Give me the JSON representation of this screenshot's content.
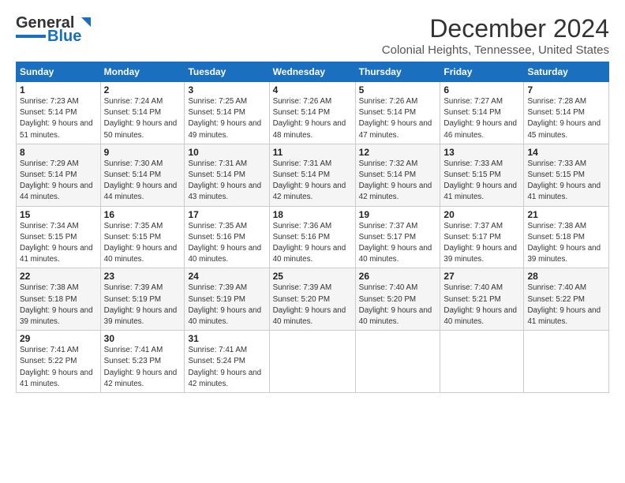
{
  "logo": {
    "part1": "General",
    "part2": "Blue"
  },
  "title": "December 2024",
  "location": "Colonial Heights, Tennessee, United States",
  "days_header": [
    "Sunday",
    "Monday",
    "Tuesday",
    "Wednesday",
    "Thursday",
    "Friday",
    "Saturday"
  ],
  "weeks": [
    [
      {
        "day": "1",
        "sunrise": "7:23 AM",
        "sunset": "5:14 PM",
        "daylight": "9 hours and 51 minutes."
      },
      {
        "day": "2",
        "sunrise": "7:24 AM",
        "sunset": "5:14 PM",
        "daylight": "9 hours and 50 minutes."
      },
      {
        "day": "3",
        "sunrise": "7:25 AM",
        "sunset": "5:14 PM",
        "daylight": "9 hours and 49 minutes."
      },
      {
        "day": "4",
        "sunrise": "7:26 AM",
        "sunset": "5:14 PM",
        "daylight": "9 hours and 48 minutes."
      },
      {
        "day": "5",
        "sunrise": "7:26 AM",
        "sunset": "5:14 PM",
        "daylight": "9 hours and 47 minutes."
      },
      {
        "day": "6",
        "sunrise": "7:27 AM",
        "sunset": "5:14 PM",
        "daylight": "9 hours and 46 minutes."
      },
      {
        "day": "7",
        "sunrise": "7:28 AM",
        "sunset": "5:14 PM",
        "daylight": "9 hours and 45 minutes."
      }
    ],
    [
      {
        "day": "8",
        "sunrise": "7:29 AM",
        "sunset": "5:14 PM",
        "daylight": "9 hours and 44 minutes."
      },
      {
        "day": "9",
        "sunrise": "7:30 AM",
        "sunset": "5:14 PM",
        "daylight": "9 hours and 44 minutes."
      },
      {
        "day": "10",
        "sunrise": "7:31 AM",
        "sunset": "5:14 PM",
        "daylight": "9 hours and 43 minutes."
      },
      {
        "day": "11",
        "sunrise": "7:31 AM",
        "sunset": "5:14 PM",
        "daylight": "9 hours and 42 minutes."
      },
      {
        "day": "12",
        "sunrise": "7:32 AM",
        "sunset": "5:14 PM",
        "daylight": "9 hours and 42 minutes."
      },
      {
        "day": "13",
        "sunrise": "7:33 AM",
        "sunset": "5:15 PM",
        "daylight": "9 hours and 41 minutes."
      },
      {
        "day": "14",
        "sunrise": "7:33 AM",
        "sunset": "5:15 PM",
        "daylight": "9 hours and 41 minutes."
      }
    ],
    [
      {
        "day": "15",
        "sunrise": "7:34 AM",
        "sunset": "5:15 PM",
        "daylight": "9 hours and 41 minutes."
      },
      {
        "day": "16",
        "sunrise": "7:35 AM",
        "sunset": "5:15 PM",
        "daylight": "9 hours and 40 minutes."
      },
      {
        "day": "17",
        "sunrise": "7:35 AM",
        "sunset": "5:16 PM",
        "daylight": "9 hours and 40 minutes."
      },
      {
        "day": "18",
        "sunrise": "7:36 AM",
        "sunset": "5:16 PM",
        "daylight": "9 hours and 40 minutes."
      },
      {
        "day": "19",
        "sunrise": "7:37 AM",
        "sunset": "5:17 PM",
        "daylight": "9 hours and 40 minutes."
      },
      {
        "day": "20",
        "sunrise": "7:37 AM",
        "sunset": "5:17 PM",
        "daylight": "9 hours and 39 minutes."
      },
      {
        "day": "21",
        "sunrise": "7:38 AM",
        "sunset": "5:18 PM",
        "daylight": "9 hours and 39 minutes."
      }
    ],
    [
      {
        "day": "22",
        "sunrise": "7:38 AM",
        "sunset": "5:18 PM",
        "daylight": "9 hours and 39 minutes."
      },
      {
        "day": "23",
        "sunrise": "7:39 AM",
        "sunset": "5:19 PM",
        "daylight": "9 hours and 39 minutes."
      },
      {
        "day": "24",
        "sunrise": "7:39 AM",
        "sunset": "5:19 PM",
        "daylight": "9 hours and 40 minutes."
      },
      {
        "day": "25",
        "sunrise": "7:39 AM",
        "sunset": "5:20 PM",
        "daylight": "9 hours and 40 minutes."
      },
      {
        "day": "26",
        "sunrise": "7:40 AM",
        "sunset": "5:20 PM",
        "daylight": "9 hours and 40 minutes."
      },
      {
        "day": "27",
        "sunrise": "7:40 AM",
        "sunset": "5:21 PM",
        "daylight": "9 hours and 40 minutes."
      },
      {
        "day": "28",
        "sunrise": "7:40 AM",
        "sunset": "5:22 PM",
        "daylight": "9 hours and 41 minutes."
      }
    ],
    [
      {
        "day": "29",
        "sunrise": "7:41 AM",
        "sunset": "5:22 PM",
        "daylight": "9 hours and 41 minutes."
      },
      {
        "day": "30",
        "sunrise": "7:41 AM",
        "sunset": "5:23 PM",
        "daylight": "9 hours and 42 minutes."
      },
      {
        "day": "31",
        "sunrise": "7:41 AM",
        "sunset": "5:24 PM",
        "daylight": "9 hours and 42 minutes."
      },
      null,
      null,
      null,
      null
    ]
  ],
  "labels": {
    "sunrise": "Sunrise:",
    "sunset": "Sunset:",
    "daylight": "Daylight:"
  }
}
